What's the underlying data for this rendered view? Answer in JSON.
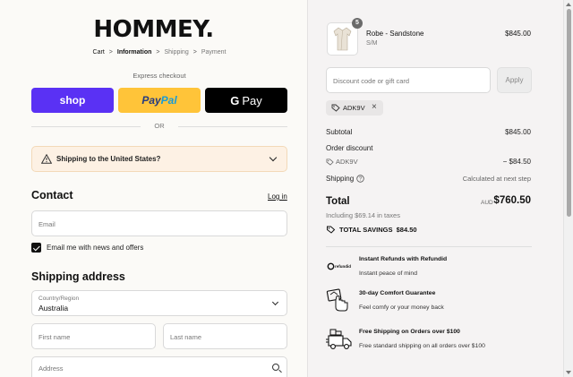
{
  "brand": {
    "logo": "HOMMEY."
  },
  "breadcrumb": [
    {
      "label": "Cart",
      "state": "link"
    },
    {
      "label": "Information",
      "state": "current"
    },
    {
      "label": "Shipping",
      "state": "upcoming"
    },
    {
      "label": "Payment",
      "state": "upcoming"
    }
  ],
  "breadcrumb_separator": ">",
  "express": {
    "heading": "Express checkout",
    "shop_label": "shop",
    "paypal_label_a": "Pay",
    "paypal_label_b": "Pal",
    "gpay_g": "G",
    "gpay_label": "Pay",
    "or_label": "OR"
  },
  "shipping_notice": {
    "text": "Shipping to the United States?",
    "icon": "warning-icon"
  },
  "contact": {
    "title": "Contact",
    "login_label": "Log in",
    "email_placeholder": "Email",
    "newsletter_label": "Email me with news and offers",
    "newsletter_checked": true
  },
  "shipping_address": {
    "title": "Shipping address",
    "country_label": "Country/Region",
    "country_value": "Australia",
    "first_name_placeholder": "First name",
    "last_name_placeholder": "Last name",
    "address_placeholder": "Address"
  },
  "order": {
    "item": {
      "name": "Robe - Sandstone",
      "variant": "S/M",
      "price": "$845.00",
      "quantity": "5"
    },
    "discount_placeholder": "Discount code or gift card",
    "apply_label": "Apply",
    "applied_code": "ADK9V",
    "subtotal_label": "Subtotal",
    "subtotal_value": "$845.00",
    "order_discount_label": "Order discount",
    "order_discount_code": "ADK9V",
    "order_discount_value": "− $84.50",
    "shipping_label": "Shipping",
    "shipping_value": "Calculated at next step",
    "total_label": "Total",
    "total_currency": "AUD",
    "total_value": "$760.50",
    "taxes_note": "Including $69.14 in taxes",
    "savings_label": "TOTAL SAVINGS",
    "savings_value": "$84.50"
  },
  "perks": [
    {
      "icon": "refundid-logo-icon",
      "title": "Instant Refunds with Refundid",
      "desc": "Instant peace of mind",
      "logo_text": "refundid"
    },
    {
      "icon": "comfort-hand-icon",
      "title": "30-day Comfort Guarantee",
      "desc": "Feel comfy or your money back"
    },
    {
      "icon": "delivery-truck-icon",
      "title": "Free Shipping on Orders over $100",
      "desc": "Free standard shipping on all orders over $100"
    }
  ],
  "colors": {
    "shop": "#5a31f4",
    "paypal": "#ffc439",
    "gpay": "#000000",
    "notice_bg": "#fdf1e4",
    "summary_bg": "#f5f3f3"
  }
}
